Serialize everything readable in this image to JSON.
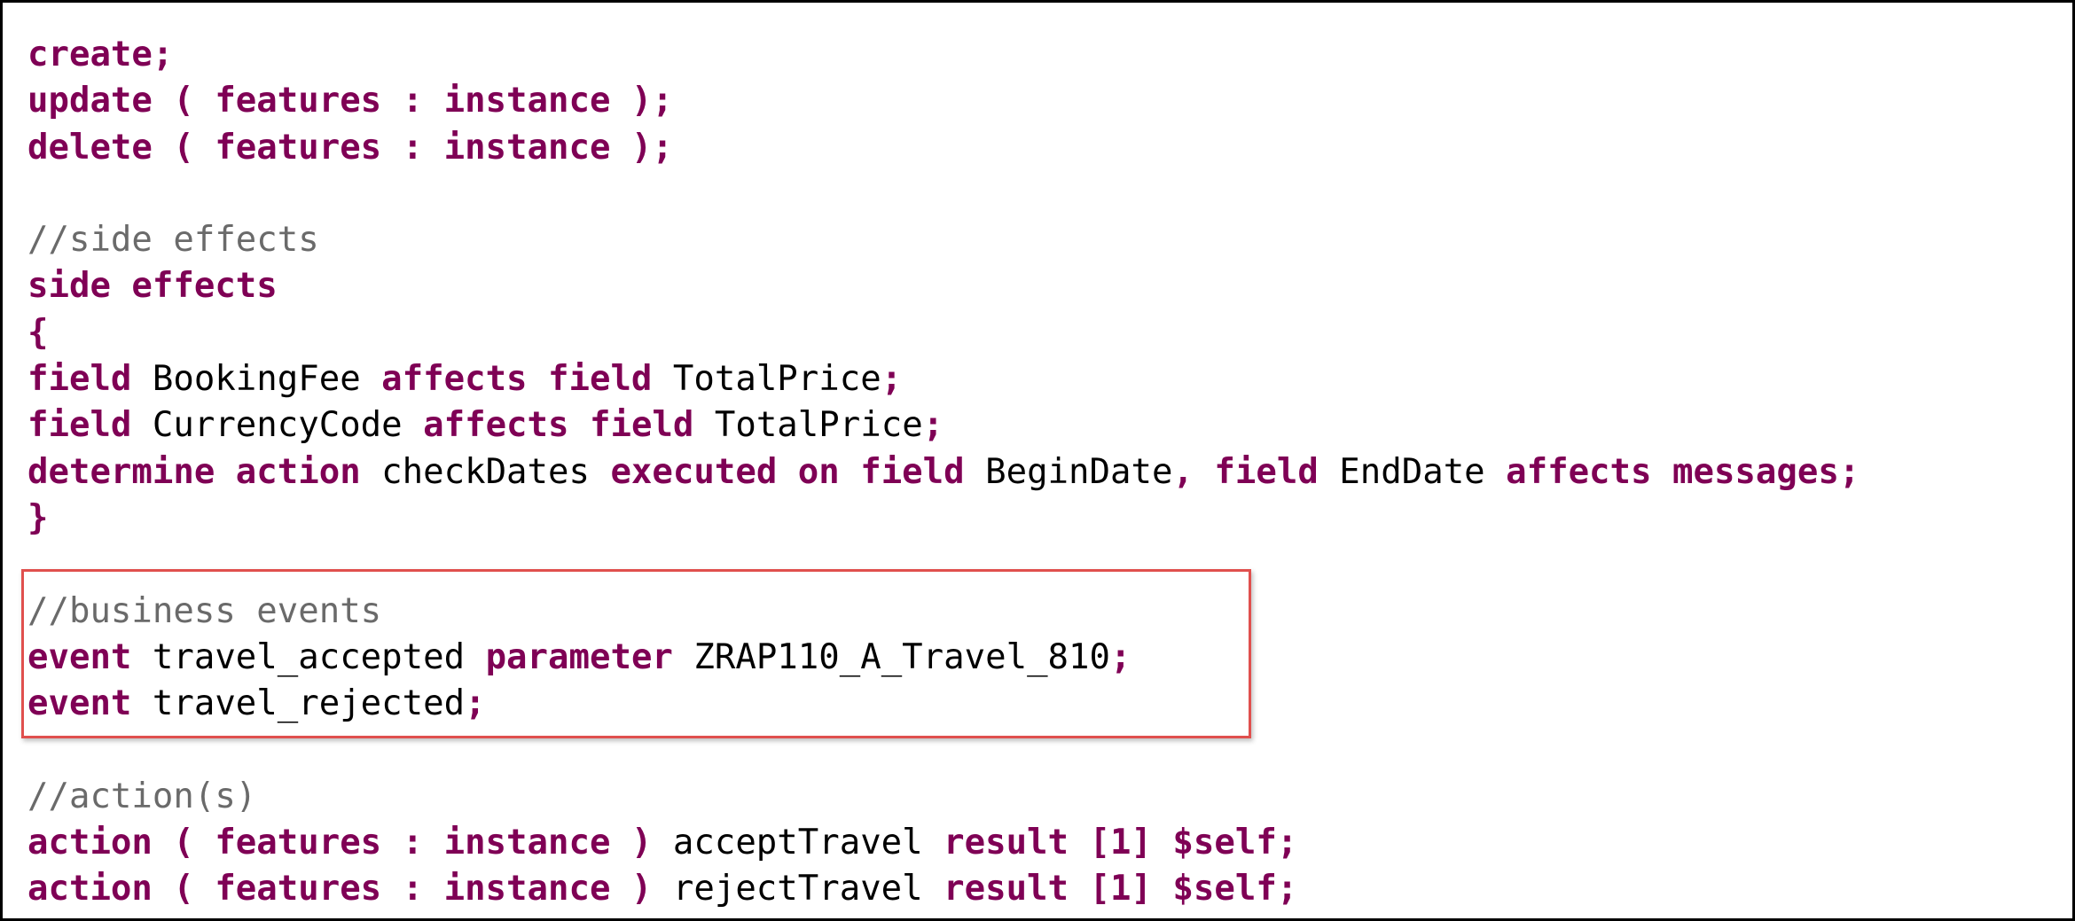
{
  "highlight": {
    "color": "#e0504e"
  },
  "colors": {
    "keyword": "#7f0055",
    "comment": "#6a6a6a",
    "plain": "#000000"
  },
  "code_lines": [
    {
      "tokens": [
        {
          "t": "kw",
          "v": "create;"
        }
      ]
    },
    {
      "tokens": [
        {
          "t": "kw",
          "v": "update ( features : instance );"
        }
      ]
    },
    {
      "tokens": [
        {
          "t": "kw",
          "v": "delete ( features : instance );"
        }
      ]
    },
    {
      "tokens": []
    },
    {
      "tokens": [
        {
          "t": "cmt",
          "v": "//side effects"
        }
      ]
    },
    {
      "tokens": [
        {
          "t": "kw",
          "v": "side effects"
        }
      ]
    },
    {
      "tokens": [
        {
          "t": "kw",
          "v": "{"
        }
      ]
    },
    {
      "tokens": [
        {
          "t": "kw",
          "v": "field"
        },
        {
          "t": "plain",
          "v": " BookingFee "
        },
        {
          "t": "kw",
          "v": "affects field"
        },
        {
          "t": "plain",
          "v": " TotalPrice"
        },
        {
          "t": "kw",
          "v": ";"
        }
      ]
    },
    {
      "tokens": [
        {
          "t": "kw",
          "v": "field"
        },
        {
          "t": "plain",
          "v": " CurrencyCode "
        },
        {
          "t": "kw",
          "v": "affects field"
        },
        {
          "t": "plain",
          "v": " TotalPrice"
        },
        {
          "t": "kw",
          "v": ";"
        }
      ]
    },
    {
      "tokens": [
        {
          "t": "kw",
          "v": "determine action"
        },
        {
          "t": "plain",
          "v": " checkDates "
        },
        {
          "t": "kw",
          "v": "executed on field"
        },
        {
          "t": "plain",
          "v": " BeginDate"
        },
        {
          "t": "kw",
          "v": ", field"
        },
        {
          "t": "plain",
          "v": " EndDate "
        },
        {
          "t": "kw",
          "v": "affects messages;"
        }
      ]
    },
    {
      "tokens": [
        {
          "t": "kw",
          "v": "}"
        }
      ]
    },
    {
      "tokens": []
    },
    {
      "tokens": [
        {
          "t": "cmt",
          "v": "//business events"
        }
      ]
    },
    {
      "tokens": [
        {
          "t": "kw",
          "v": "event"
        },
        {
          "t": "plain",
          "v": " travel_accepted "
        },
        {
          "t": "kw",
          "v": "parameter"
        },
        {
          "t": "plain",
          "v": " ZRAP110_A_Travel_810"
        },
        {
          "t": "kw",
          "v": ";"
        }
      ]
    },
    {
      "tokens": [
        {
          "t": "kw",
          "v": "event"
        },
        {
          "t": "plain",
          "v": " travel_rejected"
        },
        {
          "t": "kw",
          "v": ";"
        }
      ]
    },
    {
      "tokens": []
    },
    {
      "tokens": [
        {
          "t": "cmt",
          "v": "//action(s)"
        }
      ]
    },
    {
      "tokens": [
        {
          "t": "kw",
          "v": "action ( features : instance )"
        },
        {
          "t": "plain",
          "v": " acceptTravel "
        },
        {
          "t": "kw",
          "v": "result [1] $self;"
        }
      ]
    },
    {
      "tokens": [
        {
          "t": "kw",
          "v": "action ( features : instance )"
        },
        {
          "t": "plain",
          "v": " rejectTravel "
        },
        {
          "t": "kw",
          "v": "result [1] $self;"
        }
      ]
    }
  ]
}
